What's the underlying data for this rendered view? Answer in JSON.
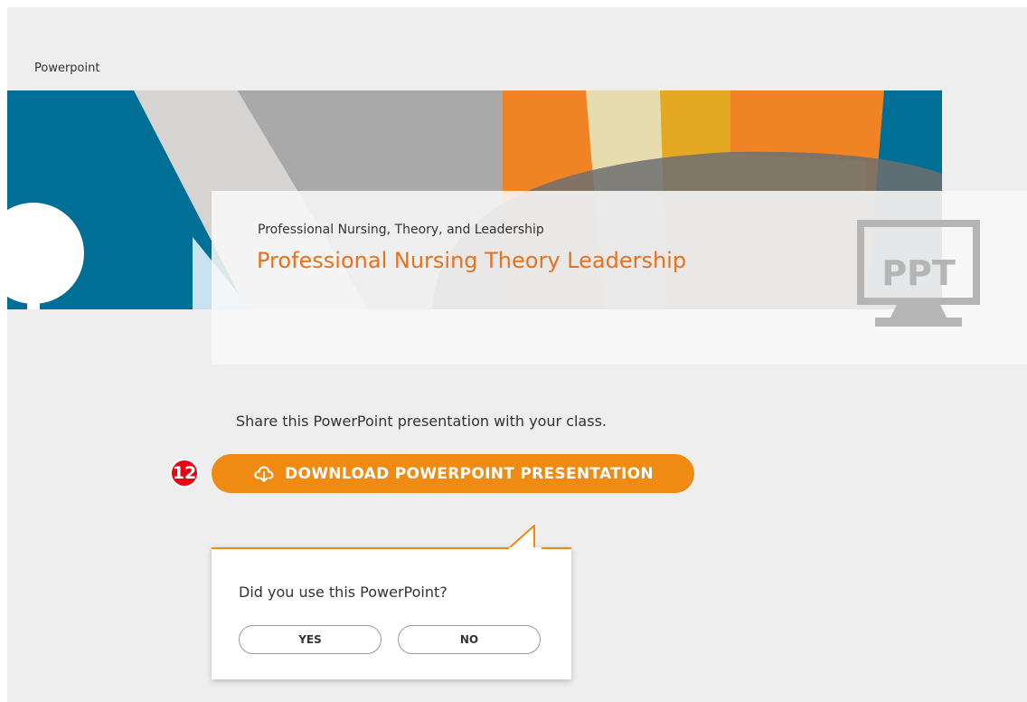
{
  "section": {
    "label": "Powerpoint"
  },
  "card": {
    "subtitle": "Professional Nursing, Theory, and Leadership",
    "title": "Professional Nursing Theory Leadership",
    "icon_text": "PPT"
  },
  "share": {
    "text": "Share this PowerPoint presentation with your class."
  },
  "step_badge": {
    "number": "12"
  },
  "download": {
    "label": "DOWNLOAD POWERPOINT PRESENTATION",
    "icon": "cloud-download-icon"
  },
  "feedback": {
    "question": "Did you use this PowerPoint?",
    "yes_label": "YES",
    "no_label": "NO"
  },
  "colors": {
    "accent_orange": "#ef8a12",
    "title_orange": "#e9711c",
    "badge_red": "#e30613",
    "banner_teal": "#006f95",
    "panel_gray": "#eeeeee"
  }
}
